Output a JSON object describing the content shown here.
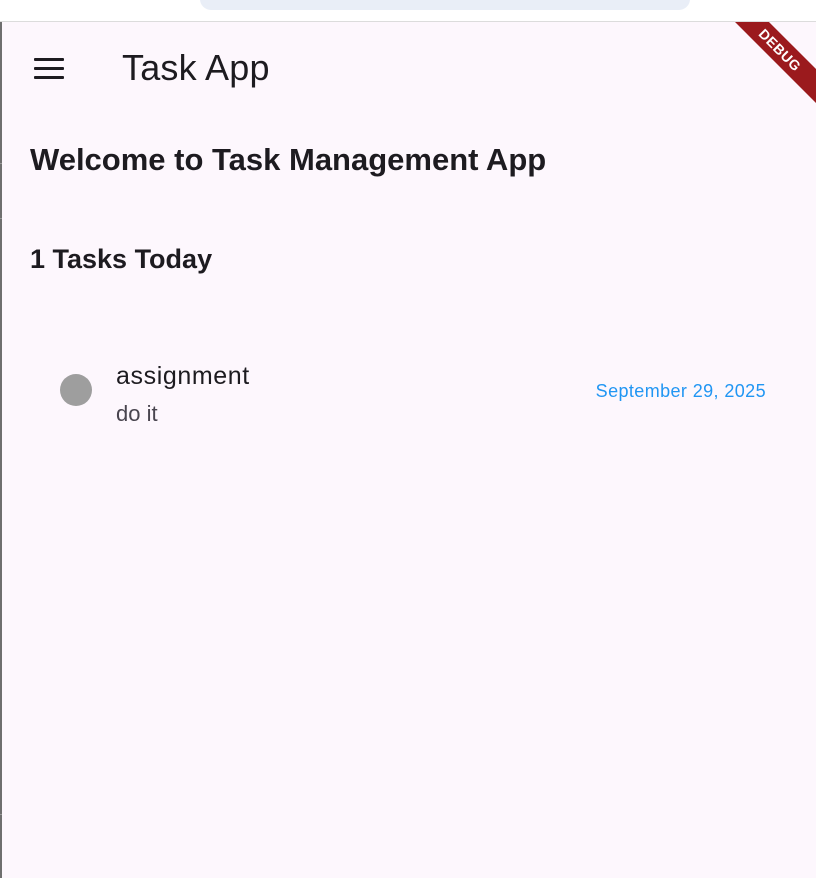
{
  "app_bar": {
    "title": "Task App",
    "menu_icon": "menu-icon"
  },
  "debug_banner": {
    "label": "DEBUG",
    "color": "#9b1a1d"
  },
  "main": {
    "welcome_heading": "Welcome to Task Management App",
    "tasks_count_heading": "1 Tasks Today"
  },
  "tasks": [
    {
      "title": "assignment",
      "description": "do it",
      "date": "September 29, 2025",
      "status_color": "#9e9e9e"
    }
  ],
  "colors": {
    "background": "#fdf7fd",
    "date_accent": "#2196f3",
    "text_primary": "#1d1b20"
  }
}
